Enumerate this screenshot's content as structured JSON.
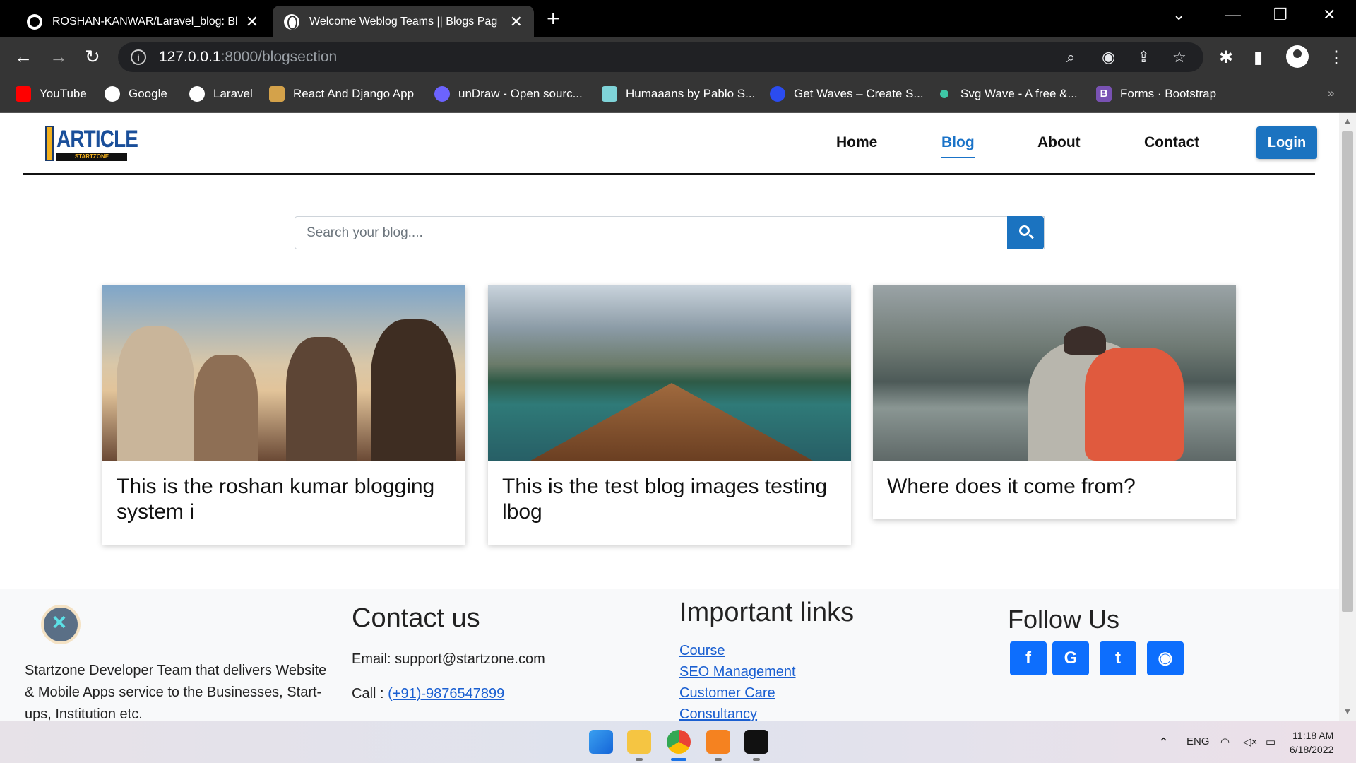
{
  "browser": {
    "tabs": [
      {
        "title": "ROSHAN-KANWAR/Laravel_blog: Bl",
        "active": false,
        "icon": "github-icon"
      },
      {
        "title": "Welcome Weblog Teams || Blogs Pag",
        "active": true,
        "icon": "globe-icon"
      }
    ],
    "url_host": "127.0.0.1",
    "url_path": ":8000/blogsection",
    "bookmarks": [
      {
        "label": "YouTube",
        "icon": "youtube-icon",
        "color": "#ff0000"
      },
      {
        "label": "Google",
        "icon": "google-icon",
        "color": "#ffffff"
      },
      {
        "label": "Laravel",
        "icon": "globe-icon",
        "color": "#ffffff"
      },
      {
        "label": "React And Django App",
        "icon": "react-django-icon",
        "color": "#d4a24a"
      },
      {
        "label": "unDraw - Open sourc...",
        "icon": "undraw-icon",
        "color": "#6c63ff"
      },
      {
        "label": "Humaaans by Pablo S...",
        "icon": "humaaans-icon",
        "color": "#7fd3d8"
      },
      {
        "label": "Get Waves – Create S...",
        "icon": "waves-icon",
        "color": "#2b4cf0"
      },
      {
        "label": "Svg Wave - A free &...",
        "icon": "svgwave-icon",
        "color": "#3ec7a6"
      },
      {
        "label": "Forms · Bootstrap",
        "icon": "bootstrap-icon",
        "color": "#7952b3"
      }
    ]
  },
  "site": {
    "logo_text": "ARTICLE",
    "logo_sub": "STARTZONE",
    "nav": [
      {
        "label": "Home",
        "active": false
      },
      {
        "label": "Blog",
        "active": true
      },
      {
        "label": "About",
        "active": false
      },
      {
        "label": "Contact",
        "active": false
      }
    ],
    "login_label": "Login",
    "search_placeholder": "Search your blog...."
  },
  "cards": [
    {
      "title": "This is the roshan kumar blogging system i",
      "image": "friends-photo"
    },
    {
      "title": "This is the test blog images testing lbog",
      "image": "lake-boat-photo"
    },
    {
      "title": "Where does it come from?",
      "image": "hiker-lake-photo"
    }
  ],
  "footer": {
    "about": "Startzone Developer Team that delivers Website & Mobile Apps service to the Businesses, Start-ups, Institution etc.",
    "contact_heading": "Contact us",
    "email_label": "Email: support@startzone.com",
    "call_label": "Call : ",
    "phone": "(+91)-9876547899",
    "links_heading": "Important links",
    "links": [
      "Course",
      "SEO Management",
      "Customer Care",
      "Consultancy"
    ],
    "follow_heading": "Follow Us",
    "social": [
      {
        "name": "facebook-icon",
        "glyph": "f"
      },
      {
        "name": "google-icon",
        "glyph": "G"
      },
      {
        "name": "twitter-icon",
        "glyph": "t"
      },
      {
        "name": "github-icon",
        "glyph": "◉"
      }
    ]
  },
  "taskbar": {
    "lang": "ENG",
    "time": "11:18 AM",
    "date": "6/18/2022"
  },
  "colors": {
    "primary": "#1b73c0",
    "chrome_dark": "#353535"
  }
}
